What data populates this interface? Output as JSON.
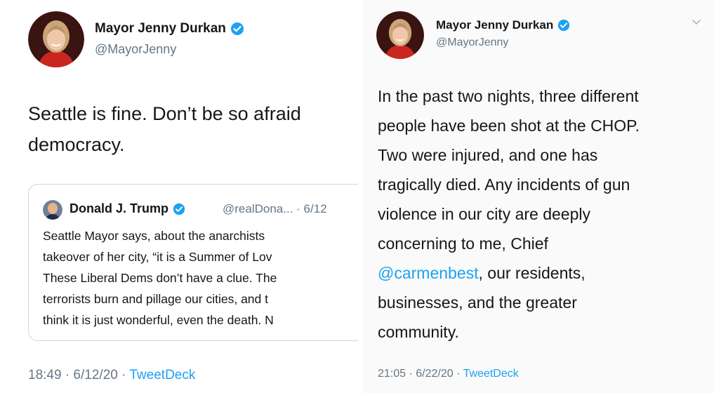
{
  "left_tweet": {
    "author_name": "Mayor Jenny Durkan",
    "handle": "@MayorJenny",
    "text": "Seattle is fine. Don’t be so afraid\ndemocracy.",
    "quoted_tweet": {
      "author_name": "Donald J. Trump",
      "meta": "@realDona... · 6/12",
      "text": "Seattle Mayor says, about the anarchists\ntakeover of her city, “it is a Summer of Lov\nThese Liberal Dems don’t have a clue. The\nterrorists burn and pillage our cities, and t\nthink it is just wonderful, even the death. N"
    },
    "timestamp": "18:49 · 6/12/20 · ",
    "source": "TweetDeck"
  },
  "right_tweet": {
    "author_name": "Mayor Jenny Durkan",
    "handle": "@MayorJenny",
    "text_before": "In the past two nights, three different\npeople have been shot at the CHOP.\nTwo were injured, and one has\ntragically died. Any incidents of gun\nviolence in our city are deeply\nconcerning to me, Chief\n",
    "mention": "@carmenbest",
    "text_after": ", our residents,\nbusinesses, and the greater\ncommunity.",
    "timestamp": "21:05 · 6/22/20 · ",
    "source": "TweetDeck"
  },
  "colors": {
    "link": "#1da1f2",
    "secondary_text": "#657786",
    "verified_badge": "#1da1f2"
  },
  "icons": {
    "verified": "verified-badge-icon",
    "more": "chevron-down-icon"
  }
}
